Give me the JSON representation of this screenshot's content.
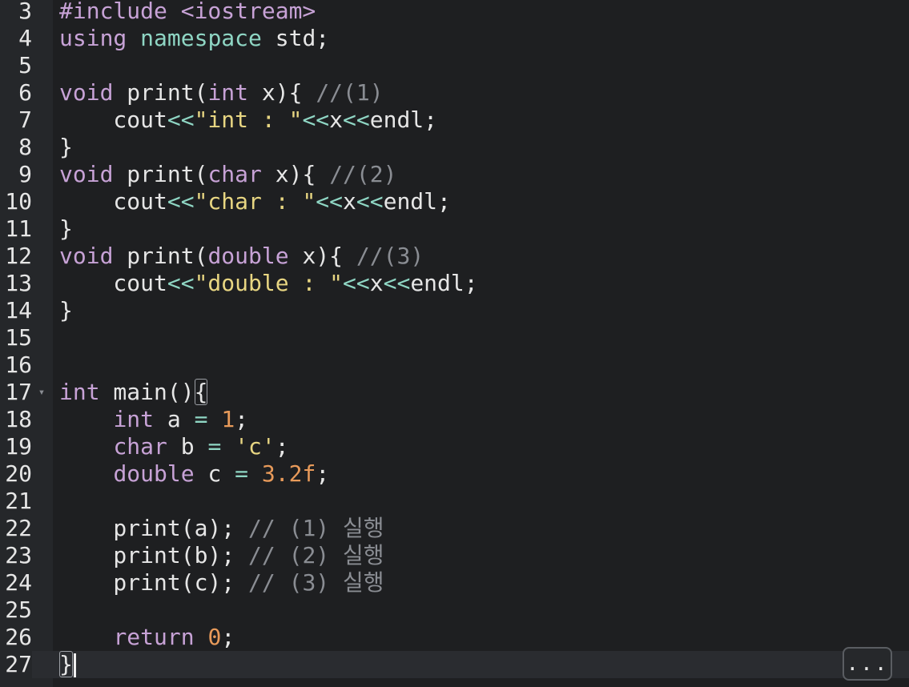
{
  "editor": {
    "more_label": "...",
    "fold_marker": "▾",
    "lines": [
      {
        "n": "3",
        "tokens": [
          {
            "t": "#include <iostream>",
            "c": "pp"
          }
        ]
      },
      {
        "n": "4",
        "tokens": [
          {
            "t": "using ",
            "c": "kw"
          },
          {
            "t": "namespace",
            "c": "ns"
          },
          {
            "t": " std;",
            "c": "plain"
          }
        ]
      },
      {
        "n": "5",
        "tokens": []
      },
      {
        "n": "6",
        "tokens": [
          {
            "t": "void",
            "c": "type"
          },
          {
            "t": " print(",
            "c": "plain"
          },
          {
            "t": "int",
            "c": "type"
          },
          {
            "t": " x){ ",
            "c": "plain"
          },
          {
            "t": "//(1)",
            "c": "comment"
          }
        ]
      },
      {
        "n": "7",
        "tokens": [
          {
            "t": "    cout",
            "c": "plain"
          },
          {
            "t": "<<",
            "c": "op"
          },
          {
            "t": "\"int : \"",
            "c": "str"
          },
          {
            "t": "<<",
            "c": "op"
          },
          {
            "t": "x",
            "c": "plain"
          },
          {
            "t": "<<",
            "c": "op"
          },
          {
            "t": "endl;",
            "c": "plain"
          }
        ]
      },
      {
        "n": "8",
        "tokens": [
          {
            "t": "}",
            "c": "plain"
          }
        ]
      },
      {
        "n": "9",
        "tokens": [
          {
            "t": "void",
            "c": "type"
          },
          {
            "t": " print(",
            "c": "plain"
          },
          {
            "t": "char",
            "c": "type"
          },
          {
            "t": " x){ ",
            "c": "plain"
          },
          {
            "t": "//(2)",
            "c": "comment"
          }
        ]
      },
      {
        "n": "10",
        "tokens": [
          {
            "t": "    cout",
            "c": "plain"
          },
          {
            "t": "<<",
            "c": "op"
          },
          {
            "t": "\"char : \"",
            "c": "str"
          },
          {
            "t": "<<",
            "c": "op"
          },
          {
            "t": "x",
            "c": "plain"
          },
          {
            "t": "<<",
            "c": "op"
          },
          {
            "t": "endl;",
            "c": "plain"
          }
        ]
      },
      {
        "n": "11",
        "tokens": [
          {
            "t": "}",
            "c": "plain"
          }
        ]
      },
      {
        "n": "12",
        "tokens": [
          {
            "t": "void",
            "c": "type"
          },
          {
            "t": " print(",
            "c": "plain"
          },
          {
            "t": "double",
            "c": "type"
          },
          {
            "t": " x){ ",
            "c": "plain"
          },
          {
            "t": "//(3)",
            "c": "comment"
          }
        ]
      },
      {
        "n": "13",
        "tokens": [
          {
            "t": "    cout",
            "c": "plain"
          },
          {
            "t": "<<",
            "c": "op"
          },
          {
            "t": "\"double : \"",
            "c": "str"
          },
          {
            "t": "<<",
            "c": "op"
          },
          {
            "t": "x",
            "c": "plain"
          },
          {
            "t": "<<",
            "c": "op"
          },
          {
            "t": "endl;",
            "c": "plain"
          }
        ]
      },
      {
        "n": "14",
        "tokens": [
          {
            "t": "}",
            "c": "plain"
          }
        ]
      },
      {
        "n": "15",
        "tokens": []
      },
      {
        "n": "16",
        "tokens": []
      },
      {
        "n": "17",
        "fold": true,
        "tokens": [
          {
            "t": "int",
            "c": "type"
          },
          {
            "t": " main()",
            "c": "plain"
          },
          {
            "t": "{",
            "c": "bracket"
          }
        ]
      },
      {
        "n": "18",
        "tokens": [
          {
            "t": "    ",
            "c": "plain"
          },
          {
            "t": "int",
            "c": "type"
          },
          {
            "t": " a ",
            "c": "plain"
          },
          {
            "t": "=",
            "c": "op"
          },
          {
            "t": " ",
            "c": "plain"
          },
          {
            "t": "1",
            "c": "num"
          },
          {
            "t": ";",
            "c": "plain"
          }
        ]
      },
      {
        "n": "19",
        "tokens": [
          {
            "t": "    ",
            "c": "plain"
          },
          {
            "t": "char",
            "c": "type"
          },
          {
            "t": " b ",
            "c": "plain"
          },
          {
            "t": "=",
            "c": "op"
          },
          {
            "t": " ",
            "c": "plain"
          },
          {
            "t": "'c'",
            "c": "str"
          },
          {
            "t": ";",
            "c": "plain"
          }
        ]
      },
      {
        "n": "20",
        "tokens": [
          {
            "t": "    ",
            "c": "plain"
          },
          {
            "t": "double",
            "c": "type"
          },
          {
            "t": " c ",
            "c": "plain"
          },
          {
            "t": "=",
            "c": "op"
          },
          {
            "t": " ",
            "c": "plain"
          },
          {
            "t": "3.2f",
            "c": "num"
          },
          {
            "t": ";",
            "c": "plain"
          }
        ]
      },
      {
        "n": "21",
        "tokens": []
      },
      {
        "n": "22",
        "tokens": [
          {
            "t": "    print(a); ",
            "c": "plain"
          },
          {
            "t": "// (1) 실행",
            "c": "comment"
          }
        ]
      },
      {
        "n": "23",
        "tokens": [
          {
            "t": "    print(b); ",
            "c": "plain"
          },
          {
            "t": "// (2) 실행",
            "c": "comment"
          }
        ]
      },
      {
        "n": "24",
        "tokens": [
          {
            "t": "    print(c); ",
            "c": "plain"
          },
          {
            "t": "// (3) 실행",
            "c": "comment"
          }
        ]
      },
      {
        "n": "25",
        "tokens": []
      },
      {
        "n": "26",
        "tokens": [
          {
            "t": "    ",
            "c": "plain"
          },
          {
            "t": "return",
            "c": "kw"
          },
          {
            "t": " ",
            "c": "plain"
          },
          {
            "t": "0",
            "c": "num"
          },
          {
            "t": ";",
            "c": "plain"
          }
        ]
      },
      {
        "n": "27",
        "active": true,
        "cursor": true,
        "tokens": [
          {
            "t": "}",
            "c": "bracket"
          }
        ]
      }
    ]
  }
}
